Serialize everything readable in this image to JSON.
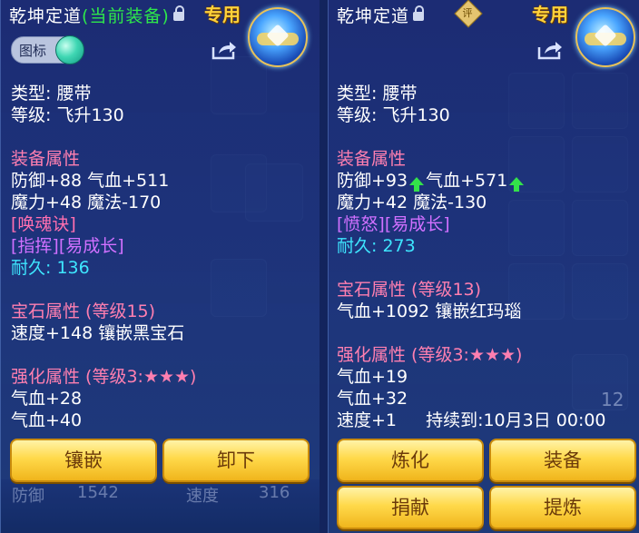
{
  "left": {
    "title_prefix": "乾坤定道",
    "title_current": "(当前装备)",
    "exclusive": "专用",
    "icon_toggle_label": "图标",
    "type": "类型: 腰带",
    "level": "等级: 飞升130",
    "equip_attr_header": "装备属性",
    "attr_line1": "防御+88 气血+511",
    "attr_line2": "魔力+48 魔法-170",
    "special1": "[唤魂诀]",
    "special2": "[指挥][易成长]",
    "durability": "耐久: 136",
    "gem_header": "宝石属性 (等级15)",
    "gem_line": "速度+148 镶嵌黑宝石",
    "enhance_header": "强化属性 (等级3:★★★)",
    "enhance1": "气血+28",
    "enhance2": "气血+40",
    "btn_inlay": "镶嵌",
    "btn_unequip": "卸下",
    "bg_defense": "防御",
    "bg_defense_val": "1542",
    "bg_speed": "速度",
    "bg_speed_val": "316"
  },
  "right": {
    "title": "乾坤定道",
    "rating_badge": "评",
    "exclusive": "专用",
    "type": "类型: 腰带",
    "level": "等级: 飞升130",
    "equip_attr_header": "装备属性",
    "attr_def": "防御+93",
    "attr_hp": "气血+571",
    "attr_line2": "魔力+42 魔法-130",
    "special1": "[愤怒][易成长]",
    "durability": "耐久: 273",
    "gem_header": "宝石属性 (等级13)",
    "gem_line": "气血+1092 镶嵌红玛瑙",
    "enhance_header": "强化属性 (等级3:★★★)",
    "enhance1": "气血+19",
    "enhance2": "气血+32",
    "enhance3": "速度+1",
    "enhance3_duration": "持续到:10月3日 00:00",
    "btn_refine": "炼化",
    "btn_equip": "装备",
    "btn_donate": "捐献",
    "btn_extract": "提炼",
    "bg_number": "12"
  },
  "colors": {
    "current_equip": "#2ee84a",
    "exclusive": "#ffd23a",
    "section_header": "#ff7fb0",
    "durability": "#3ee6ff",
    "special_pink": "#ff6fb0",
    "special_purple": "#d070ff",
    "up_arrow": "#33e24a"
  },
  "icons": [
    "lock-icon",
    "share-icon",
    "gear-emblem-icon",
    "toggle-knob-icon",
    "up-arrow-icon",
    "rating-badge-icon"
  ]
}
